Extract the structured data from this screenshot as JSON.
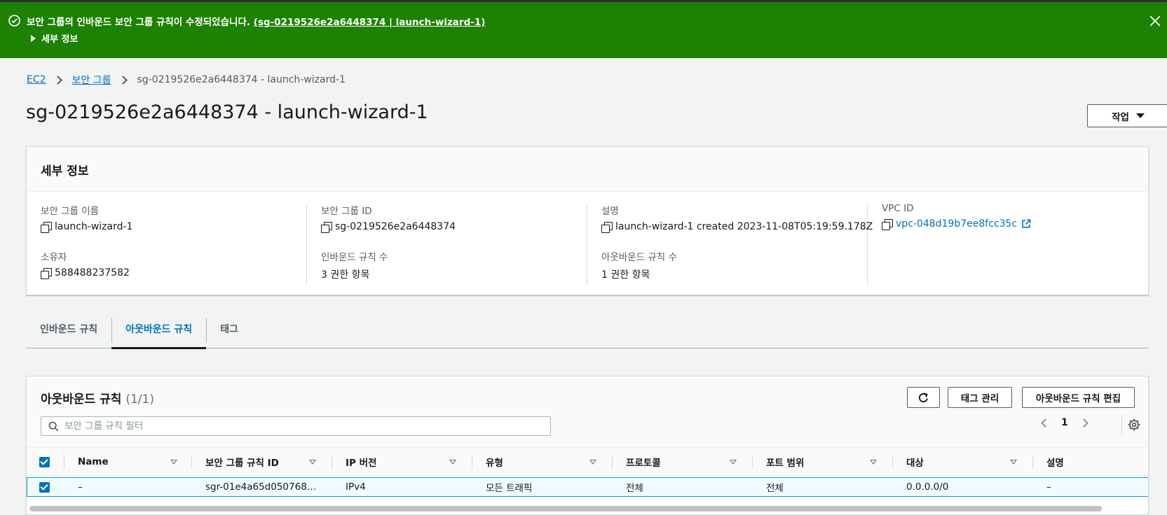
{
  "flash": {
    "message": "보안 그룹의 인바운드 보안 그룹 규칙이 수정되었습니다.",
    "link": "(sg-0219526e2a6448374 | launch-wizard-1)",
    "details_label": "세부 정보",
    "color": "#1d8102"
  },
  "breadcrumb": {
    "ec2": "EC2",
    "security_groups": "보안 그룹",
    "current": "sg-0219526e2a6448374 - launch-wizard-1"
  },
  "page": {
    "title": "sg-0219526e2a6448374 - launch-wizard-1",
    "actions_label": "작업"
  },
  "details": {
    "header": "세부 정보",
    "sg_name_label": "보안 그룹 이름",
    "sg_name": "launch-wizard-1",
    "sg_id_label": "보안 그룹 ID",
    "sg_id": "sg-0219526e2a6448374",
    "description_label": "설명",
    "description": "launch-wizard-1 created 2023-11-08T05:19:59.178Z",
    "vpc_label": "VPC ID",
    "vpc_id": "vpc-048d19b7ee8fcc35c",
    "owner_label": "소유자",
    "owner": "588488237582",
    "inbound_count_label": "인바운드 규칙 수",
    "inbound_count": "3 권한 항목",
    "outbound_count_label": "아웃바운드 규칙 수",
    "outbound_count": "1 권한 항목"
  },
  "tabs": [
    {
      "label": "인바운드 규칙"
    },
    {
      "label": "아웃바운드 규칙",
      "active": true
    },
    {
      "label": "태그"
    }
  ],
  "rules": {
    "title": "아웃바운드 규칙",
    "count": "(1/1)",
    "manage_tags": "태그 관리",
    "edit_rules": "아웃바운드 규칙 편집",
    "filter_placeholder": "보안 그룹 규칙 필터",
    "page": "1",
    "columns": [
      "Name",
      "보안 그룹 규칙 ID",
      "IP 버전",
      "유형",
      "프로토콜",
      "포트 범위",
      "대상",
      "설명"
    ],
    "rows": [
      {
        "name": "–",
        "rule_id": "sgr-01e4a65d050768…",
        "ip_version": "IPv4",
        "type": "모든 트래픽",
        "protocol": "전체",
        "port_range": "전체",
        "destination": "0.0.0.0/0",
        "description": "–"
      }
    ]
  },
  "colors": {
    "link": "#0073bb",
    "selected_row_bg": "#f1faff",
    "selected_row_border": "#00a1c9"
  }
}
